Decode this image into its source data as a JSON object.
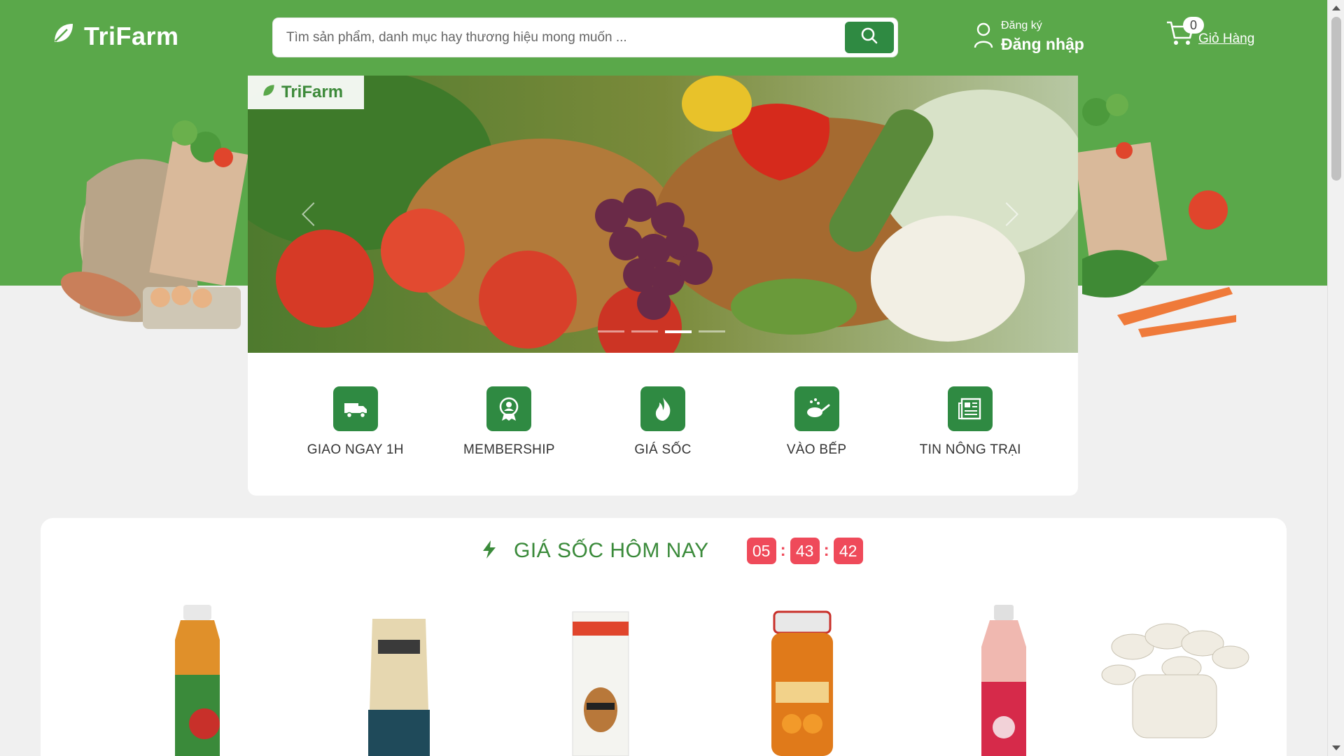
{
  "header": {
    "logo_text": "TriFarm",
    "search_placeholder": "Tìm sản phẩm, danh mục hay thương hiệu mong muốn ...",
    "account_register": "Đăng ký",
    "account_login": "Đăng nhập",
    "cart_count": "0",
    "cart_label": "Giỏ Hàng"
  },
  "banner": {
    "tag_text": "TriFarm",
    "slide_count": 4,
    "active_slide": 3
  },
  "features": [
    {
      "label": "GIAO NGAY 1H",
      "icon": "delivery-truck-icon"
    },
    {
      "label": "MEMBERSHIP",
      "icon": "membership-badge-icon"
    },
    {
      "label": "GIÁ SỐC",
      "icon": "fire-icon"
    },
    {
      "label": "VÀO BẾP",
      "icon": "cooking-pan-icon"
    },
    {
      "label": "TIN NÔNG TRẠI",
      "icon": "newspaper-icon"
    }
  ],
  "flash_sale": {
    "title": "GIÁ SỐC HÔM NAY",
    "icon": "lightning-icon",
    "timer": {
      "hours": "05",
      "minutes": "43",
      "seconds": "42"
    },
    "products": [
      {
        "image": "apple-juice-bottle"
      },
      {
        "image": "coffee-bag"
      },
      {
        "image": "almond-milk-carton"
      },
      {
        "image": "orange-marmalade-jar"
      },
      {
        "image": "lychee-drink-bottle"
      },
      {
        "image": "white-mushrooms"
      }
    ]
  },
  "colors": {
    "brand_green": "#5aa84a",
    "button_green": "#2f8a42",
    "timer_red": "#ef4a5a",
    "background": "#f0f0f0"
  }
}
